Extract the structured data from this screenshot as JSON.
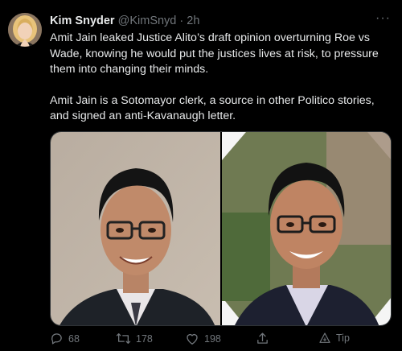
{
  "tweet": {
    "author_name": "Kim Snyder",
    "handle": "@KimSnyd",
    "separator": "·",
    "time": "2h",
    "more_label": "···",
    "paragraphs": [
      "Amit Jain leaked Justice Alito’s draft opinion overturning Roe vs Wade, knowing he would put the justices lives at risk, to pressure them into changing their minds.",
      "Amit Jain is a Sotomayor clerk, a source in other Politico stories, and signed an anti-Kavanaugh letter."
    ]
  },
  "media": {
    "photo_count": 2
  },
  "actions": {
    "reply_count": "68",
    "retweet_count": "178",
    "like_count": "198",
    "tip_label": "Tip",
    "icons": [
      "reply-icon",
      "retweet-icon",
      "like-icon",
      "share-icon",
      "tip-icon"
    ]
  },
  "colors": {
    "background": "#000000",
    "text_primary": "#e7e9ea",
    "text_secondary": "#71767b",
    "border": "#2f3336"
  }
}
